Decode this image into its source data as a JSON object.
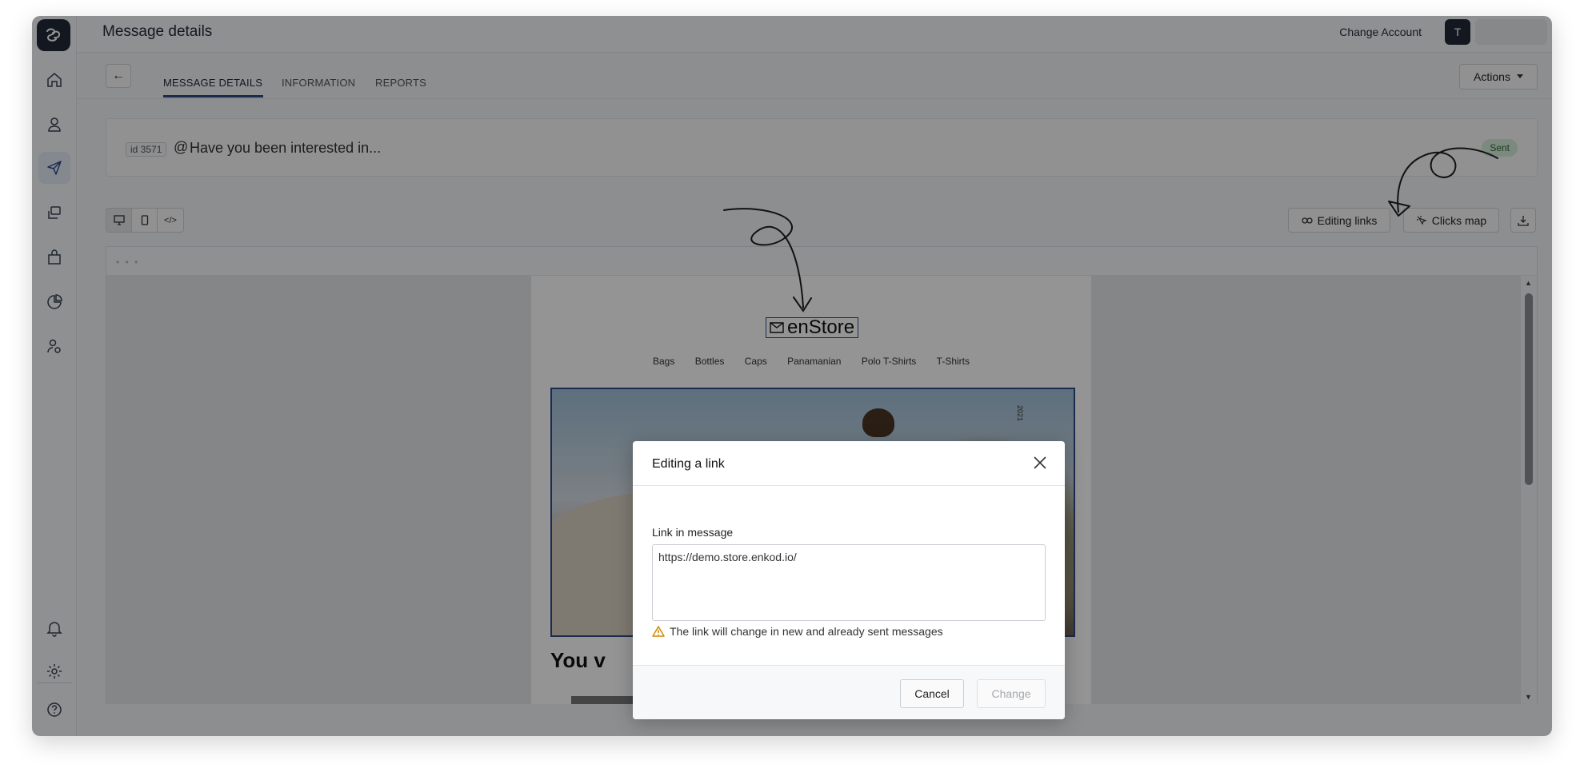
{
  "header": {
    "title": "Message details",
    "change_account": "Change Account",
    "avatar_initial": "T"
  },
  "tabs": {
    "back": "←",
    "items": [
      "MESSAGE DETAILS",
      "INFORMATION",
      "REPORTS"
    ],
    "active": "MESSAGE DETAILS",
    "actions_label": "Actions"
  },
  "subject": {
    "id": "id 3571",
    "at": "@",
    "text": "Have you been interested in...",
    "status": "Sent"
  },
  "toolbar": {
    "code_label": "</>",
    "editing_links": "Editing links",
    "clicks_map": "Clicks map"
  },
  "preview": {
    "dots": "• • •",
    "brand": "enStore",
    "nav": [
      "Bags",
      "Bottles",
      "Caps",
      "Panamanian",
      "Polo T-Shirts",
      "T-Shirts"
    ],
    "hero_year": "2021",
    "heading": "You v"
  },
  "modal": {
    "title": "Editing a link",
    "field_label": "Link in message",
    "link_value": "https://demo.store.enkod.io/",
    "warning": "The link will change in new and already sent messages",
    "cancel": "Cancel",
    "change": "Change"
  },
  "colors": {
    "accent": "#2f4a8a",
    "sent_badge": "#d4ecd9",
    "warning_icon": "#d08a00"
  }
}
